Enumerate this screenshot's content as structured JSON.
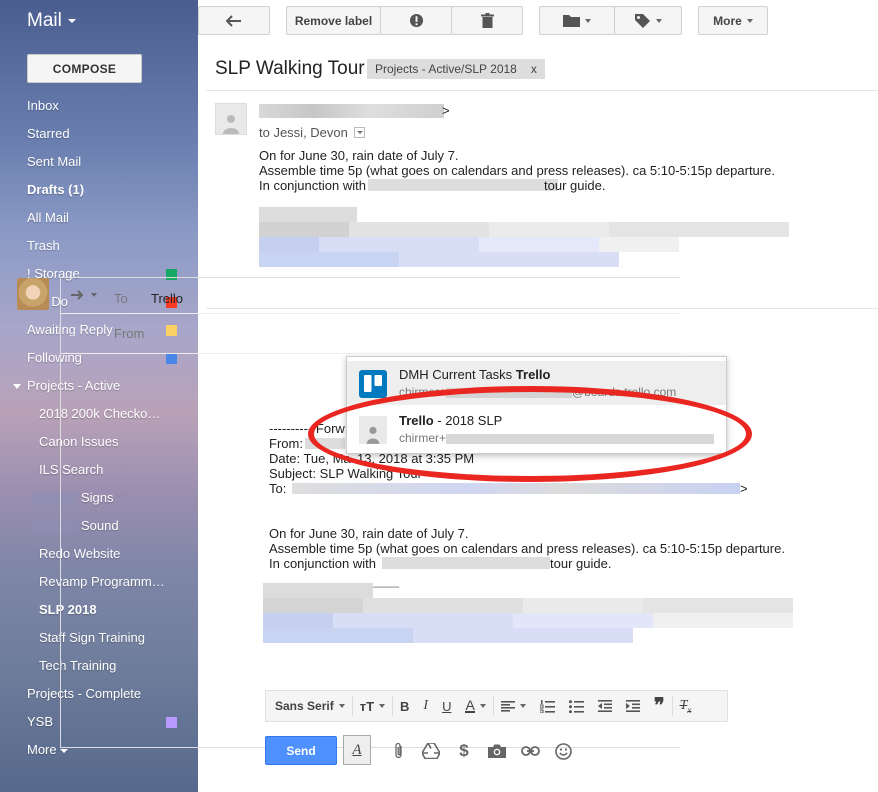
{
  "sidebar": {
    "title": "Mail",
    "compose_label": "COMPOSE",
    "items": [
      {
        "label": "Inbox"
      },
      {
        "label": "Starred"
      },
      {
        "label": "Sent Mail"
      },
      {
        "label": "Drafts (1)"
      },
      {
        "label": "All Mail"
      },
      {
        "label": "Trash"
      },
      {
        "label": "! Storage",
        "color": "#16a765"
      },
      {
        "label": "! To Do",
        "color": "#f83a22"
      },
      {
        "label": "Awaiting Reply",
        "color": "#fad165"
      },
      {
        "label": "Following",
        "color": "#4986e7"
      },
      {
        "label": "Projects - Active"
      },
      {
        "label": "2018 200k Checko…"
      },
      {
        "label": "Canon Issues"
      },
      {
        "label": "ILS Search"
      },
      {
        "label": "Signs"
      },
      {
        "label": "Sound"
      },
      {
        "label": "Redo Website"
      },
      {
        "label": "Revamp Programm…"
      },
      {
        "label": "SLP 2018"
      },
      {
        "label": "Staff Sign Training"
      },
      {
        "label": "Tech Training"
      },
      {
        "label": "Projects - Complete"
      },
      {
        "label": "YSB",
        "color": "#b99aff"
      },
      {
        "label": "More"
      }
    ]
  },
  "toolbar": {
    "remove_label": "Remove label",
    "more_label": "More"
  },
  "thread": {
    "subject": "SLP Walking Tour",
    "label_chip": "Projects - Active/SLP 2018",
    "label_chip_close": "x",
    "sender_suffix": ">",
    "recipients": "to Jessi, Devon",
    "body": [
      "On for June 30, rain date of July 7.",
      "Assemble time 5p (what goes on calendars and press releases). ca 5:10-5:15p departure.",
      "In conjunction with",
      "tour guide."
    ]
  },
  "reply": {
    "to_label": "To",
    "to_value": "Trello",
    "from_label": "From",
    "forward_prefix": "---------- Forw",
    "from_line": "From:",
    "date_line": "Date: Tue, Ma",
    "date_tail": "13, 2018 at 3:35 PM",
    "subject_line": "Subject: SLP Walking Tour",
    "to_line": "To:",
    "to_line_tail": ">",
    "body": [
      "On for June 30, rain date of July 7.",
      "Assemble time 5p (what goes on calendars and press releases). ca 5:10-5:15p departure.",
      "In conjunction with",
      "tour guide."
    ],
    "sig_line": "__________________"
  },
  "autocomplete": [
    {
      "name_prefix": "DMH Current Tasks ",
      "name_bold": "Trello",
      "email_prefix": "chirmer+",
      "email_suffix": "@boards.trello.com",
      "highlighted": true
    },
    {
      "name_bold": "Trello",
      "name_suffix": " - 2018 SLP",
      "email_prefix": "chirmer+",
      "email_suffix": "",
      "highlighted": false
    }
  ],
  "format_bar": {
    "font_label": "Sans Serif"
  },
  "compose": {
    "send_label": "Send"
  },
  "colors": {
    "accent_red": "#e9261f",
    "send_blue": "#4d90fe",
    "trello_blue": "#0079bf"
  }
}
